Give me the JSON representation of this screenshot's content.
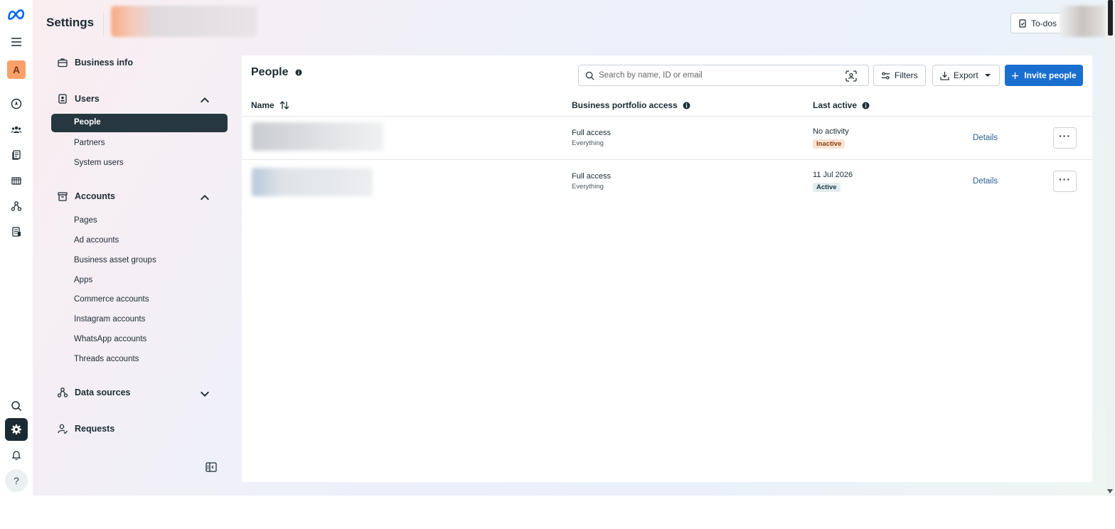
{
  "header": {
    "title": "Settings",
    "todos_label": "To-dos"
  },
  "rail": {
    "avatar_letter": "A",
    "help_label": "?"
  },
  "sidenav": {
    "business_info": "Business info",
    "users": {
      "label": "Users",
      "items": [
        "People",
        "Partners",
        "System users"
      ]
    },
    "accounts": {
      "label": "Accounts",
      "items": [
        "Pages",
        "Ad accounts",
        "Business asset groups",
        "Apps",
        "Commerce accounts",
        "Instagram accounts",
        "WhatsApp accounts",
        "Threads accounts"
      ]
    },
    "data_sources": "Data sources",
    "requests": "Requests"
  },
  "main": {
    "title": "People",
    "search": {
      "placeholder": "Search by name, ID or email"
    },
    "filters_label": "Filters",
    "export_label": "Export",
    "invite_label": "Invite people",
    "columns": {
      "name": "Name",
      "access": "Business portfolio access",
      "last_active": "Last active"
    },
    "rows": [
      {
        "access": "Full access",
        "access_scope": "Everything",
        "last_active": "No activity",
        "status": "Inactive",
        "details": "Details",
        "more": "···"
      },
      {
        "access": "Full access",
        "access_scope": "Everything",
        "last_active": "11 Jul 2026",
        "status": "Active",
        "details": "Details",
        "more": "···"
      }
    ]
  },
  "colors": {
    "accent": "#1a6ed0",
    "nav_selected": "#273740",
    "avatar": "#f7a06a",
    "badge_inactive": "#fbe4d3",
    "badge_active": "#e4ecee"
  }
}
